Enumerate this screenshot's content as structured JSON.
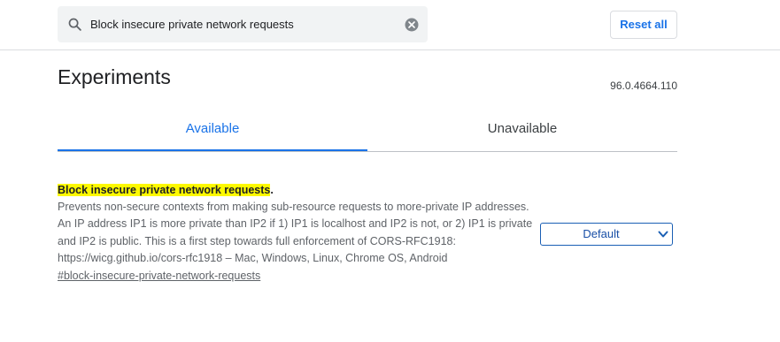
{
  "search": {
    "value": "Block insecure private network requests",
    "icon": "search-icon",
    "clear_icon": "clear-icon"
  },
  "header": {
    "reset_label": "Reset all"
  },
  "main": {
    "title": "Experiments",
    "version": "96.0.4664.110",
    "tabs": [
      {
        "label": "Available",
        "active": true
      },
      {
        "label": "Unavailable",
        "active": false
      }
    ]
  },
  "experiment": {
    "title": "Block insecure private network requests",
    "title_suffix": ".",
    "description": "Prevents non-secure contexts from making sub-resource requests to more-private IP addresses. An IP address IP1 is more private than IP2 if 1) IP1 is localhost and IP2 is not, or 2) IP1 is private and IP2 is public. This is a first step towards full enforcement of CORS-RFC1918: https://wicg.github.io/cors-rfc1918 – Mac, Windows, Linux, Chrome OS, Android",
    "link": "#block-insecure-private-network-requests",
    "select_value": "Default"
  },
  "colors": {
    "accent": "#1a73e8",
    "highlight": "#fdf900",
    "search_bg": "#f1f3f4",
    "select_border": "#1a5fb4"
  }
}
